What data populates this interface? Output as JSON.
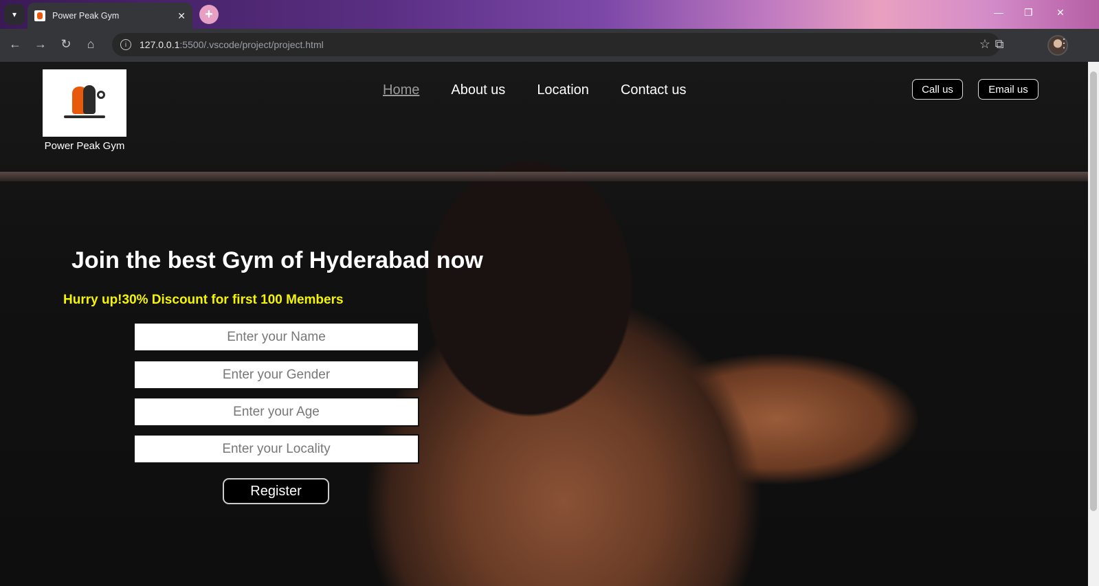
{
  "browser": {
    "tab_title": "Power Peak Gym",
    "url_host": "127.0.0.1",
    "url_path": ":5500/.vscode/project/project.html"
  },
  "site": {
    "brand_name": "Power Peak Gym",
    "nav": [
      "Home",
      "About us",
      "Location",
      "Contact us"
    ],
    "call_label": "Call us",
    "email_label": "Email us"
  },
  "hero": {
    "headline": "Join the best Gym of Hyderabad now",
    "offer": "Hurry up!30% Discount for first 100 Members"
  },
  "form": {
    "name_placeholder": "Enter your Name",
    "gender_placeholder": "Enter your Gender",
    "age_placeholder": "Enter your Age",
    "locality_placeholder": "Enter your Locality",
    "register_label": "Register"
  },
  "colors": {
    "offer_text": "#f5f500",
    "active_nav": "#9a9a9a"
  }
}
